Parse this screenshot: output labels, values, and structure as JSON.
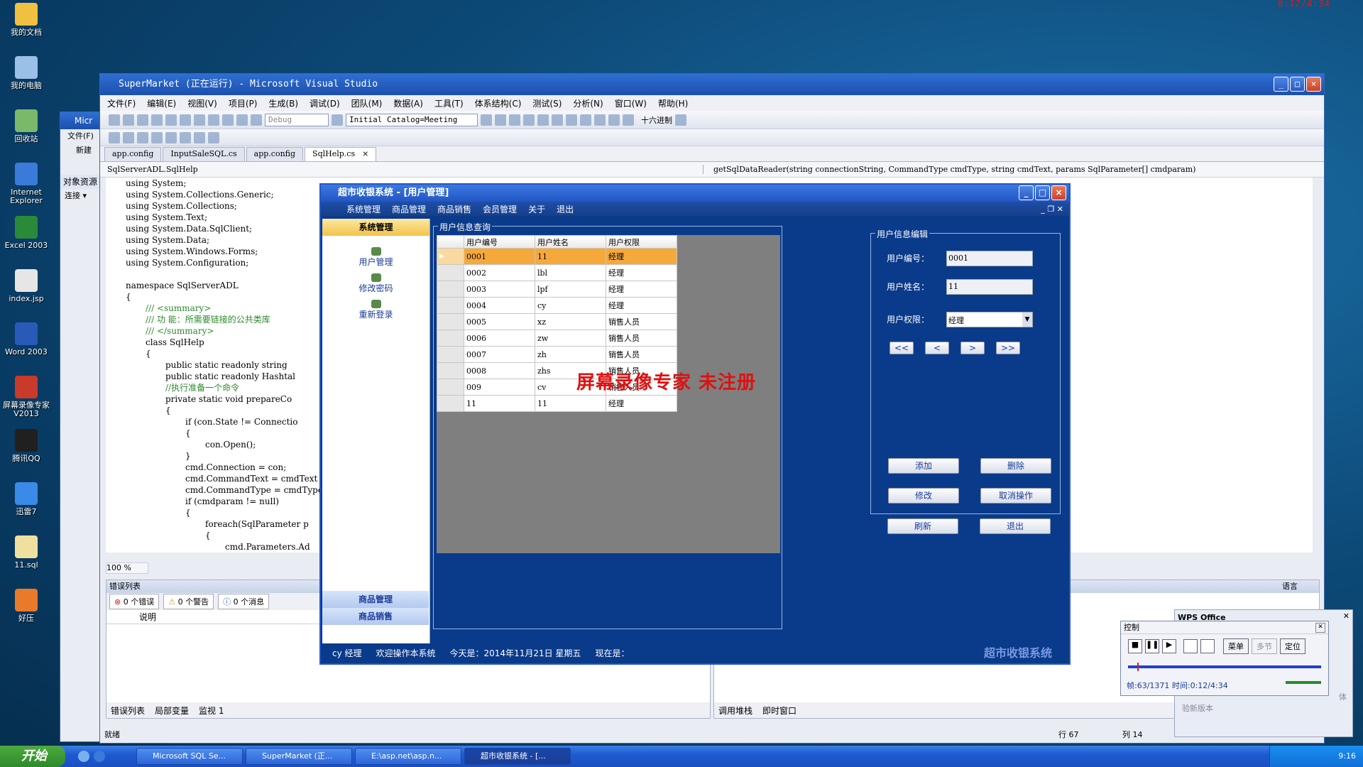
{
  "clock_top": "0:12/4:34",
  "desktop_icons": [
    {
      "label": "我的文档",
      "color": "#f0c040"
    },
    {
      "label": "我的电脑",
      "color": "#9ac0e8"
    },
    {
      "label": "回收站",
      "color": "#7ab86a"
    },
    {
      "label": "Internet\nExplorer",
      "color": "#3a7ad8"
    },
    {
      "label": "Excel 2003",
      "color": "#2a8a3a"
    },
    {
      "label": "index.jsp",
      "color": "#e6e6e6"
    },
    {
      "label": "Word 2003",
      "color": "#2a5ab8"
    },
    {
      "label": "屏幕录像专家\nV2013",
      "color": "#c83a2a"
    },
    {
      "label": "腾讯QQ",
      "color": "#202020"
    },
    {
      "label": "迅雷7",
      "color": "#3a8ae8"
    },
    {
      "label": "11.sql",
      "color": "#f0e0a0"
    },
    {
      "label": "好压",
      "color": "#e87a2a"
    }
  ],
  "oe_window": {
    "title": "Micr",
    "file_menu": "文件(F)",
    "new_btn": "新建",
    "panel_title": "对象资源",
    "connect": "连接 ▾"
  },
  "vs": {
    "title": "SuperMarket (正在运行) - Microsoft Visual Studio",
    "menu": [
      "文件(F)",
      "编辑(E)",
      "视图(V)",
      "项目(P)",
      "生成(B)",
      "调试(D)",
      "团队(M)",
      "数据(A)",
      "工具(T)",
      "体系结构(C)",
      "测试(S)",
      "分析(N)",
      "窗口(W)",
      "帮助(H)"
    ],
    "config_combo": "Debug",
    "catalog_combo": "Initial Catalog=Meeting",
    "hex_label": "十六进制",
    "tabs": [
      "app.config",
      "InputSaleSQL.cs",
      "app.config",
      "SqlHelp.cs"
    ],
    "class_combo": "SqlServerADL.SqlHelp",
    "member_combo": "getSqlDataReader(string connectionString, CommandType cmdType, string cmdText, params SqlParameter[] cmdparam)",
    "zoom": "100 %",
    "status_ready": "就绪",
    "status_line": "行 67",
    "status_col": "列 14"
  },
  "code_lines": [
    "using System;",
    "using System.Collections.Generic;",
    "using System.Collections;",
    "using System.Text;",
    "using System.Data.SqlClient;",
    "using System.Data;",
    "using System.Windows.Forms;",
    "using System.Configuration;",
    "namespace SqlServerADL",
    "{",
    "/// <summary>",
    "/// 功   能：所需要链接的公共类库",
    "/// </summary>",
    "class SqlHelp",
    "{",
    "public static readonly string",
    "public static readonly Hashtal",
    "//执行准备一个命令",
    "private static void prepareCo",
    "{",
    "if (con.State != Connectio",
    "{",
    "con.Open();",
    "}",
    "cmd.Connection = con;",
    "cmd.CommandText = cmdText",
    "cmd.CommandType = cmdType",
    "if (cmdparam != null)",
    "{",
    "foreach(SqlParameter p",
    "{",
    "cmd.Parameters.Ad"
  ],
  "error_list": {
    "title": "错误列表",
    "errors": "0 个错误",
    "warnings": "0 个警告",
    "messages": "0 个消息",
    "col_desc": "说明",
    "tabs": [
      "错误列表",
      "局部变量",
      "监视 1"
    ],
    "lang": "语言"
  },
  "callstack_tabs": [
    "调用堆栈",
    "即时窗口"
  ],
  "app": {
    "title": "超市收银系统 - [用户管理]",
    "menu": [
      "系统管理",
      "商品管理",
      "商品销售",
      "会员管理",
      "关于",
      "退出"
    ],
    "nav_header": "系统管理",
    "nav_items": [
      "用户管理",
      "修改密码",
      "重新登录"
    ],
    "nav_footer": [
      "商品管理",
      "商品销售"
    ],
    "query_group": "用户信息查询",
    "edit_group": "用户信息编辑",
    "columns": [
      "用户编号",
      "用户姓名",
      "用户权限"
    ],
    "rows": [
      [
        "0001",
        "11",
        "经理"
      ],
      [
        "0002",
        "lbl",
        "经理"
      ],
      [
        "0003",
        "lpf",
        "经理"
      ],
      [
        "0004",
        "cy",
        "经理"
      ],
      [
        "0005",
        "xz",
        "销售人员"
      ],
      [
        "0006",
        "zw",
        "销售人员"
      ],
      [
        "0007",
        "zh",
        "销售人员"
      ],
      [
        "0008",
        "zhs",
        "销售人员"
      ],
      [
        "009",
        "cv",
        "销售人员"
      ],
      [
        "11",
        "11",
        "经理"
      ]
    ],
    "form": {
      "id_label": "用户编号：",
      "id_value": "0001",
      "name_label": "用户姓名：",
      "name_value": "11",
      "role_label": "用户权限：",
      "role_value": "经理"
    },
    "nav_buttons": [
      "<<",
      "<",
      ">",
      ">>"
    ],
    "buttons": {
      "add": "添加",
      "delete": "删除",
      "edit": "修改",
      "cancel": "取消操作",
      "refresh": "刷新",
      "exit": "退出"
    },
    "status": {
      "user": "cy 经理",
      "welcome": "欢迎操作本系统",
      "today": "今天是：2014年11月21日 星期五",
      "now": "现在是：",
      "brand": "超市收银系统"
    }
  },
  "watermark": "屏幕录像专家  未注册",
  "recorder": {
    "title": "控制",
    "menu_btn": "菜单",
    "multi_btn": "多节",
    "locate_btn": "定位",
    "info": "帧:63/1371 时间:0:12/4:34",
    "progress": 0.046
  },
  "wps": {
    "brand": "WPS Office",
    "update": "验新版本",
    "font_hint": "体"
  },
  "taskbar": {
    "start": "开始",
    "tasks": [
      "Microsoft SQL Se...",
      "SuperMarket (正...",
      "E:\\asp.net\\asp.n...",
      "超市收银系统 - [..."
    ],
    "clock": "9:16"
  }
}
